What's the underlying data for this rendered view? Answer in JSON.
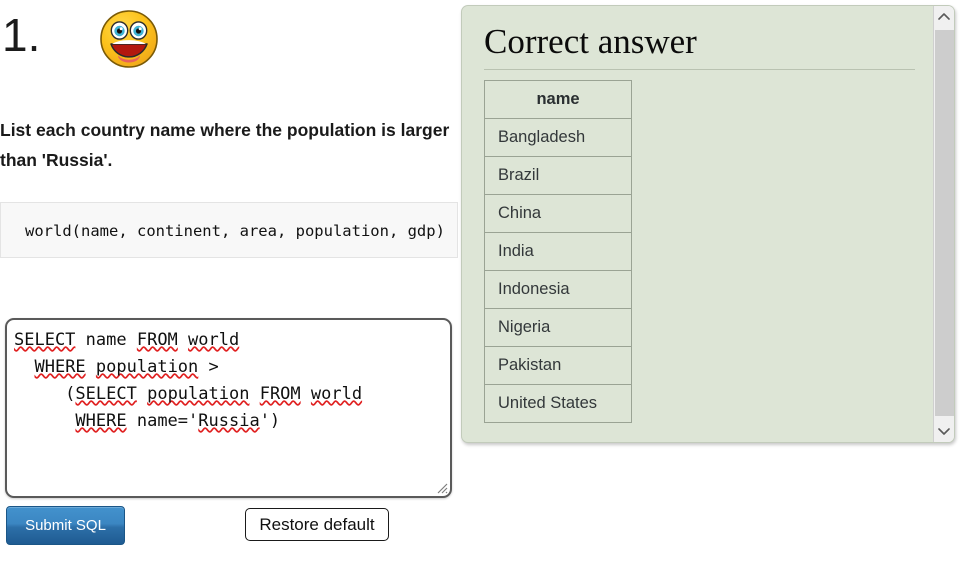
{
  "question": {
    "number": "1.",
    "icon": "smiley-face-icon",
    "prompt": "List each country name where the population is larger than 'Russia'.",
    "schema": "world(name, continent, area, population, gdp)"
  },
  "editor": {
    "sql_lines": [
      "SELECT name FROM world",
      "  WHERE population >",
      "     (SELECT population FROM world",
      "      WHERE name='Russia')"
    ],
    "sql_value": "SELECT name FROM world\n  WHERE population >\n     (SELECT population FROM world\n      WHERE name='Russia')",
    "spellcheck_words": [
      "SELECT",
      "FROM",
      "world",
      "WHERE",
      "population",
      "Russia"
    ]
  },
  "buttons": {
    "submit_label": "Submit SQL",
    "restore_label": "Restore default"
  },
  "answer_panel": {
    "title": "Correct answer",
    "columns": [
      "name"
    ],
    "rows": [
      [
        "Bangladesh"
      ],
      [
        "Brazil"
      ],
      [
        "China"
      ],
      [
        "India"
      ],
      [
        "Indonesia"
      ],
      [
        "Nigeria"
      ],
      [
        "Pakistan"
      ],
      [
        "United States"
      ]
    ],
    "scrollbar": {
      "up_icon": "chevron-up-icon",
      "down_icon": "chevron-down-icon"
    }
  },
  "colors": {
    "panel_background": "#dde5d6",
    "panel_border": "#c2cbbb",
    "table_border": "#9aa394",
    "submit_button_top": "#4392cd",
    "submit_button_bottom": "#1f5b92",
    "spellcheck_underline": "#e02020",
    "schema_background": "#f8f8f8",
    "page_background": "#ffffff"
  }
}
